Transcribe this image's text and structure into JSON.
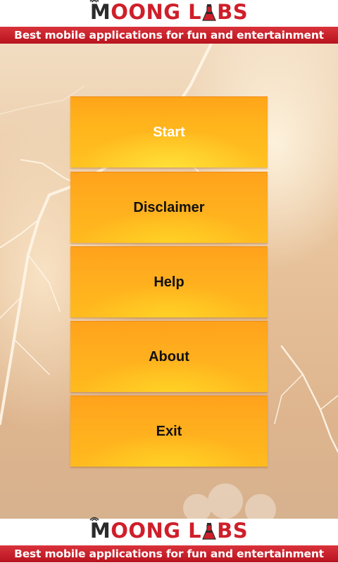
{
  "header": {
    "brand_first": "M",
    "brand_rest": "OONG L",
    "brand_a": "A",
    "brand_end": "BS",
    "tagline": "Best mobile applications for fun and entertainment"
  },
  "menu": {
    "items": [
      {
        "label": "Start",
        "active": true
      },
      {
        "label": "Disclaimer",
        "active": false
      },
      {
        "label": "Help",
        "active": false
      },
      {
        "label": "About",
        "active": false
      },
      {
        "label": "Exit",
        "active": false
      }
    ]
  },
  "footer": {
    "brand_first": "M",
    "brand_rest": "OONG L",
    "brand_a": "A",
    "brand_end": "BS",
    "tagline": "Best mobile applications for fun and entertainment"
  },
  "colors": {
    "brand_red": "#cf1f2a",
    "button_orange": "#ffad1e",
    "background": "#e8c9a4"
  },
  "icons": [
    "wifi-signal-icon",
    "flask-icon"
  ]
}
